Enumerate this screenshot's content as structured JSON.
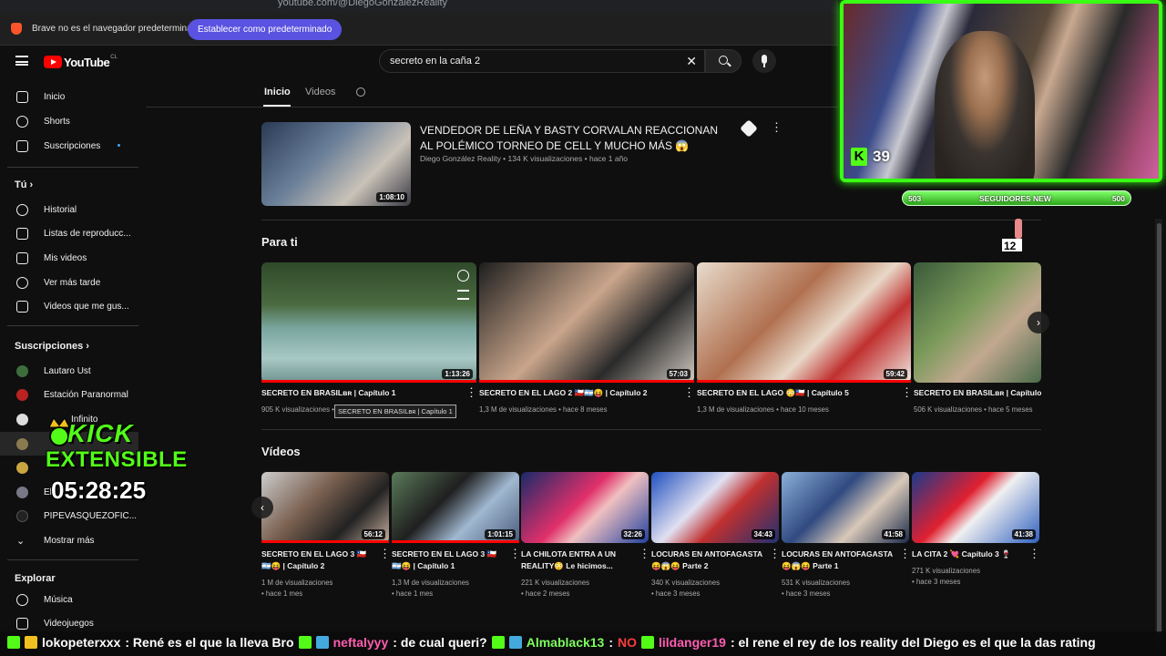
{
  "browser": {
    "url": "youtube.com/@DiegoGonzalezReality",
    "infobar_message": "Brave no es el navegador predeterminado",
    "infobar_button": "Establecer como predeterminado"
  },
  "header": {
    "logo_text": "YouTube",
    "logo_country": "CL",
    "search_value": "secreto en la caña 2"
  },
  "sidebar": {
    "main": [
      {
        "label": "Inicio",
        "icon": "home-icon"
      },
      {
        "label": "Shorts",
        "icon": "shorts-icon"
      },
      {
        "label": "Suscripciones",
        "icon": "subscriptions-icon"
      }
    ],
    "you_title": "Tú",
    "you": [
      {
        "label": "Historial",
        "icon": "history-icon"
      },
      {
        "label": "Listas de reproducc...",
        "icon": "playlists-icon"
      },
      {
        "label": "Mis videos",
        "icon": "my-videos-icon"
      },
      {
        "label": "Ver más tarde",
        "icon": "watch-later-icon"
      },
      {
        "label": "Videos que me gus...",
        "icon": "liked-videos-icon"
      }
    ],
    "subs_title": "Suscripciones",
    "subs": [
      {
        "label": "Lautaro Ust"
      },
      {
        "label": "Estación Paranormal"
      },
      {
        "label": "Infinito"
      },
      {
        "label": ""
      },
      {
        "label": ""
      },
      {
        "label": "El"
      },
      {
        "label": "PIPEVASQUEZOFIC..."
      }
    ],
    "show_more": "Mostrar más",
    "explore_title": "Explorar",
    "explore": [
      {
        "label": "Música",
        "icon": "music-icon"
      },
      {
        "label": "Videojuegos",
        "icon": "gaming-icon"
      }
    ]
  },
  "tabs": [
    {
      "label": "Inicio",
      "active": true
    },
    {
      "label": "Videos",
      "active": false
    }
  ],
  "featured": {
    "title": "VENDEDOR DE LEÑA Y BASTY CORVALAN REACCIONAN AL POLÉMICO TORNEO DE CELL Y MUCHO MÁS 😱",
    "meta": "Diego González Reality • 134 K visualizaciones • hace 1 año",
    "duration": "1:08:10"
  },
  "para_ti": {
    "title": "Para ti",
    "cards": [
      {
        "title": "SECRETO EN BRASILʙʀ | Capítulo 1",
        "meta": "905 K visualizaciones • hace 7 meses",
        "duration": "1:13:26",
        "progress": 1.0
      },
      {
        "title": "SECRETO EN EL LAGO 2 🇨🇱🇦🇷😝 | Capítulo 2",
        "meta": "1,3 M de visualizaciones • hace 8 meses",
        "duration": "57:03",
        "progress": 1.0
      },
      {
        "title": "SECRETO EN EL LAGO 😳🇨🇱 | Capítulo 5",
        "meta": "1,3 M de visualizaciones • hace 10 meses",
        "duration": "59:42",
        "progress": 1.0
      },
      {
        "title": "SECRETO EN BRASILʙʀ | Capítulo",
        "meta": "506 K visualizaciones • hace 5 meses",
        "duration": "",
        "progress": 0
      }
    ],
    "tooltip": "SECRETO EN BRASILʙʀ | Capítulo 1"
  },
  "videos": {
    "title": "Vídeos",
    "cards": [
      {
        "title1": "SECRETO EN EL LAGO 3 🇨🇱",
        "title2": "🇦🇷😝 | Capítulo 2",
        "views": "1 M de visualizaciones",
        "age": "• hace 1 mes",
        "duration": "56:12",
        "progress": 1.0
      },
      {
        "title1": "SECRETO EN EL LAGO 3 🇨🇱",
        "title2": "🇦🇷😝 | Capítulo 1",
        "views": "1,3 M de visualizaciones",
        "age": "• hace 1 mes",
        "duration": "1:01:15",
        "progress": 1.0
      },
      {
        "title1": "LA CHILOTA ENTRA A UN",
        "title2": "REALITY😳 Le hicimos...",
        "views": "221 K visualizaciones",
        "age": "• hace 2 meses",
        "duration": "32:26",
        "progress": 0
      },
      {
        "title1": "LOCURAS EN ANTOFAGASTA",
        "title2": "😝😱😝 Parte 2",
        "views": "340 K visualizaciones",
        "age": "• hace 3 meses",
        "duration": "34:43",
        "progress": 0
      },
      {
        "title1": "LOCURAS EN ANTOFAGASTA",
        "title2": "😝😱😝 Parte 1",
        "views": "531 K visualizaciones",
        "age": "• hace 3 meses",
        "duration": "41:58",
        "progress": 0
      },
      {
        "title1": "LA CITA 2 💘 Capítulo 3 🍷",
        "title2": "",
        "views": "271 K visualizaciones",
        "age": "• hace 3 meses",
        "duration": "41:38",
        "progress": 0
      }
    ]
  },
  "overlay": {
    "viewers": "39",
    "goal_left": "503",
    "goal_label": "SEGUIDORES NEW",
    "goal_right": "500",
    "kick_word": "KICK",
    "kick_sub": "EXTENSIBLE",
    "kick_time": "05:28:25",
    "chat": [
      {
        "user": "lokopeterxxx",
        "msg": ": René es el que la lleva Bro"
      },
      {
        "user": "neftalyyy",
        "msg": ": de cual queri?"
      },
      {
        "user": "Almablack13",
        "msg": ":"
      },
      {
        "user": "NO",
        "msg": ""
      },
      {
        "user": "lildanger19",
        "msg": ": el rene el rey de los reality del Diego es el que la das rating"
      }
    ]
  },
  "colors": {
    "accent_red": "#ff0000",
    "kick_green": "#53fc18",
    "infobar_button": "#5a52e0"
  }
}
